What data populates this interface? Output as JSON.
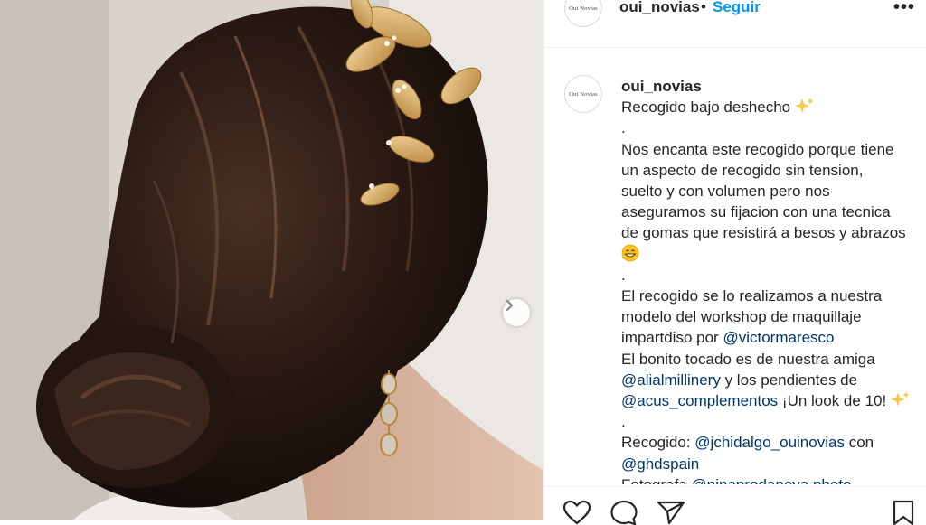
{
  "post": {
    "username": "oui_novias",
    "avatar_text": "Oui Novias",
    "separator": "•",
    "follow_label": "Seguir",
    "more_label": "•••"
  },
  "caption": {
    "username": "oui_novias",
    "lines": [
      "Recogido bajo deshecho",
      ".",
      "Nos encanta este recogido porque tiene",
      "un aspecto de recogido sin tension,",
      "suelto y con volumen pero nos",
      "aseguramos su fijacion con una tecnica",
      "de gomas que resistirá a besos y abrazos",
      ".",
      "El recogido se lo realizamos a nuestra",
      "modelo del workshop de maquillaje",
      "impartdiso por",
      "@victormaresco",
      "El bonito tocado es de nuestra amiga",
      "@alialmillinery",
      "y los pendientes de",
      "@acus_complementos",
      "¡Un look de 10!",
      ".",
      "Recogido:",
      "@jchidalgo_ouinovias",
      "con",
      "@ghdspain",
      "Fotografa",
      "@ninaprodanova.photo"
    ]
  },
  "icons": {
    "sparkles": "sparkles-icon",
    "grin": "grinning-face-icon",
    "next": "chevron-right-icon",
    "like": "heart-icon",
    "comment": "comment-icon",
    "share": "paper-plane-icon",
    "save": "bookmark-icon"
  },
  "colors": {
    "link": "#00376b",
    "follow": "#0095f6",
    "text": "#262626"
  }
}
